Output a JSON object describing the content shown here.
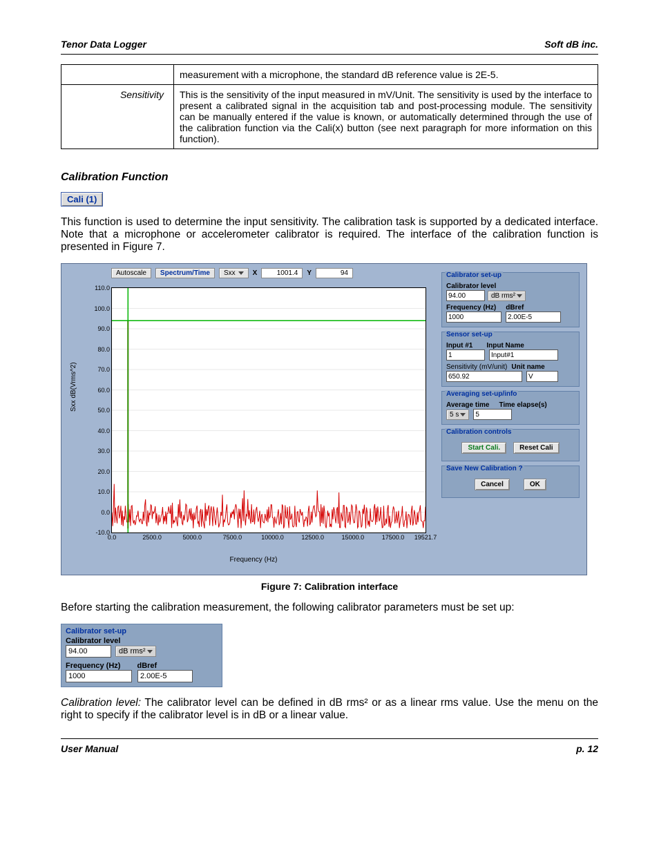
{
  "header": {
    "left": "Tenor Data Logger",
    "right": "Soft dB inc."
  },
  "footer": {
    "left": "User Manual",
    "right": "p. 12"
  },
  "table_rows": [
    {
      "label": "",
      "text": "measurement with a microphone, the standard dB reference value is 2E-5."
    },
    {
      "label": "Sensitivity",
      "text": "This is the sensitivity of the input measured in mV/Unit. The sensitivity is used by the interface to present a calibrated signal in the acquisition tab and post-processing module. The sensitivity can be manually entered if the value is known, or automatically determined through the use of the calibration function via the Cali(x) button (see next paragraph for more information on this function)."
    }
  ],
  "section_title": "Calibration Function",
  "cali_button_label": "Cali (1)",
  "para1": "This function is used to determine the input sensitivity. The calibration task is supported by a dedicated interface. Note that a microphone or accelerometer calibrator is required. The interface of the calibration function is presented in Figure 7.",
  "figure7_caption": "Figure 7: Calibration interface",
  "para2": "Before starting the calibration measurement, the following calibrator parameters must be set up:",
  "para3_prefix": "Calibration level:",
  "para3_rest": " The calibrator level can be defined in dB rms² or as a linear rms value. Use the menu on the right to specify if the calibrator level is in dB or a linear value.",
  "figure7": {
    "toolbar": {
      "autoscale": "Autoscale",
      "spectrum_time": "Spectrum/Time",
      "series": "Sxx",
      "x_label": "X",
      "x_value": "1001.4",
      "y_label": "Y",
      "y_value": "94"
    },
    "ylabel": "Sxx dB(Vrms^2)",
    "xlabel": "Frequency (Hz)",
    "calibrator": {
      "title": "Calibrator set-up",
      "level_label": "Calibrator level",
      "level_value": "94.00",
      "level_unit": "dB rms²",
      "freq_label": "Frequency (Hz)",
      "freq_value": "1000",
      "dbref_label": "dBref",
      "dbref_value": "2.00E-5"
    },
    "sensor": {
      "title": "Sensor set-up",
      "input_label": "Input #1",
      "input_value": "1",
      "name_label": "Input Name",
      "name_value": "Input#1",
      "sens_label": "Sensitivity (mV/unit)",
      "sens_value": "650.92",
      "unit_label": "Unit name",
      "unit_value": "V"
    },
    "averaging": {
      "title": "Averaging set-up/info",
      "avg_label": "Average time",
      "avg_value": "5 s",
      "elapse_label": "Time elapse(s)",
      "elapse_value": "5"
    },
    "controls": {
      "title": "Calibration controls",
      "start": "Start Cali.",
      "reset": "Reset Cali"
    },
    "save": {
      "title": "Save New Calibration ?",
      "cancel": "Cancel",
      "ok": "OK"
    }
  },
  "small_panel": {
    "title": "Calibrator set-up",
    "level_label": "Calibrator level",
    "level_value": "94.00",
    "level_unit": "dB rms²",
    "freq_label": "Frequency (Hz)",
    "freq_value": "1000",
    "dbref_label": "dBref",
    "dbref_value": "2.00E-5"
  },
  "chart_data": {
    "type": "line",
    "title": "",
    "xlabel": "Frequency (Hz)",
    "ylabel": "Sxx dB(Vrms^2)",
    "xlim": [
      0,
      19521.7
    ],
    "ylim": [
      -10,
      110
    ],
    "x_ticks": [
      0.0,
      2500.0,
      5000.0,
      7500.0,
      10000.0,
      12500.0,
      15000.0,
      17500.0,
      19521.7
    ],
    "y_ticks": [
      -10.0,
      0.0,
      10.0,
      20.0,
      30.0,
      40.0,
      50.0,
      60.0,
      70.0,
      80.0,
      90.0,
      100.0,
      110.0
    ],
    "cursor": {
      "x": 1001.4,
      "y": 94
    },
    "peak": {
      "x": 1000,
      "y": 94
    },
    "noise_floor_range_db": [
      -10,
      5
    ],
    "series": [
      {
        "name": "Sxx",
        "description": "Single 94 dB peak at ~1000 Hz; broadband noise floor between roughly -10 and +5 dB across 0–19.5 kHz"
      }
    ]
  }
}
